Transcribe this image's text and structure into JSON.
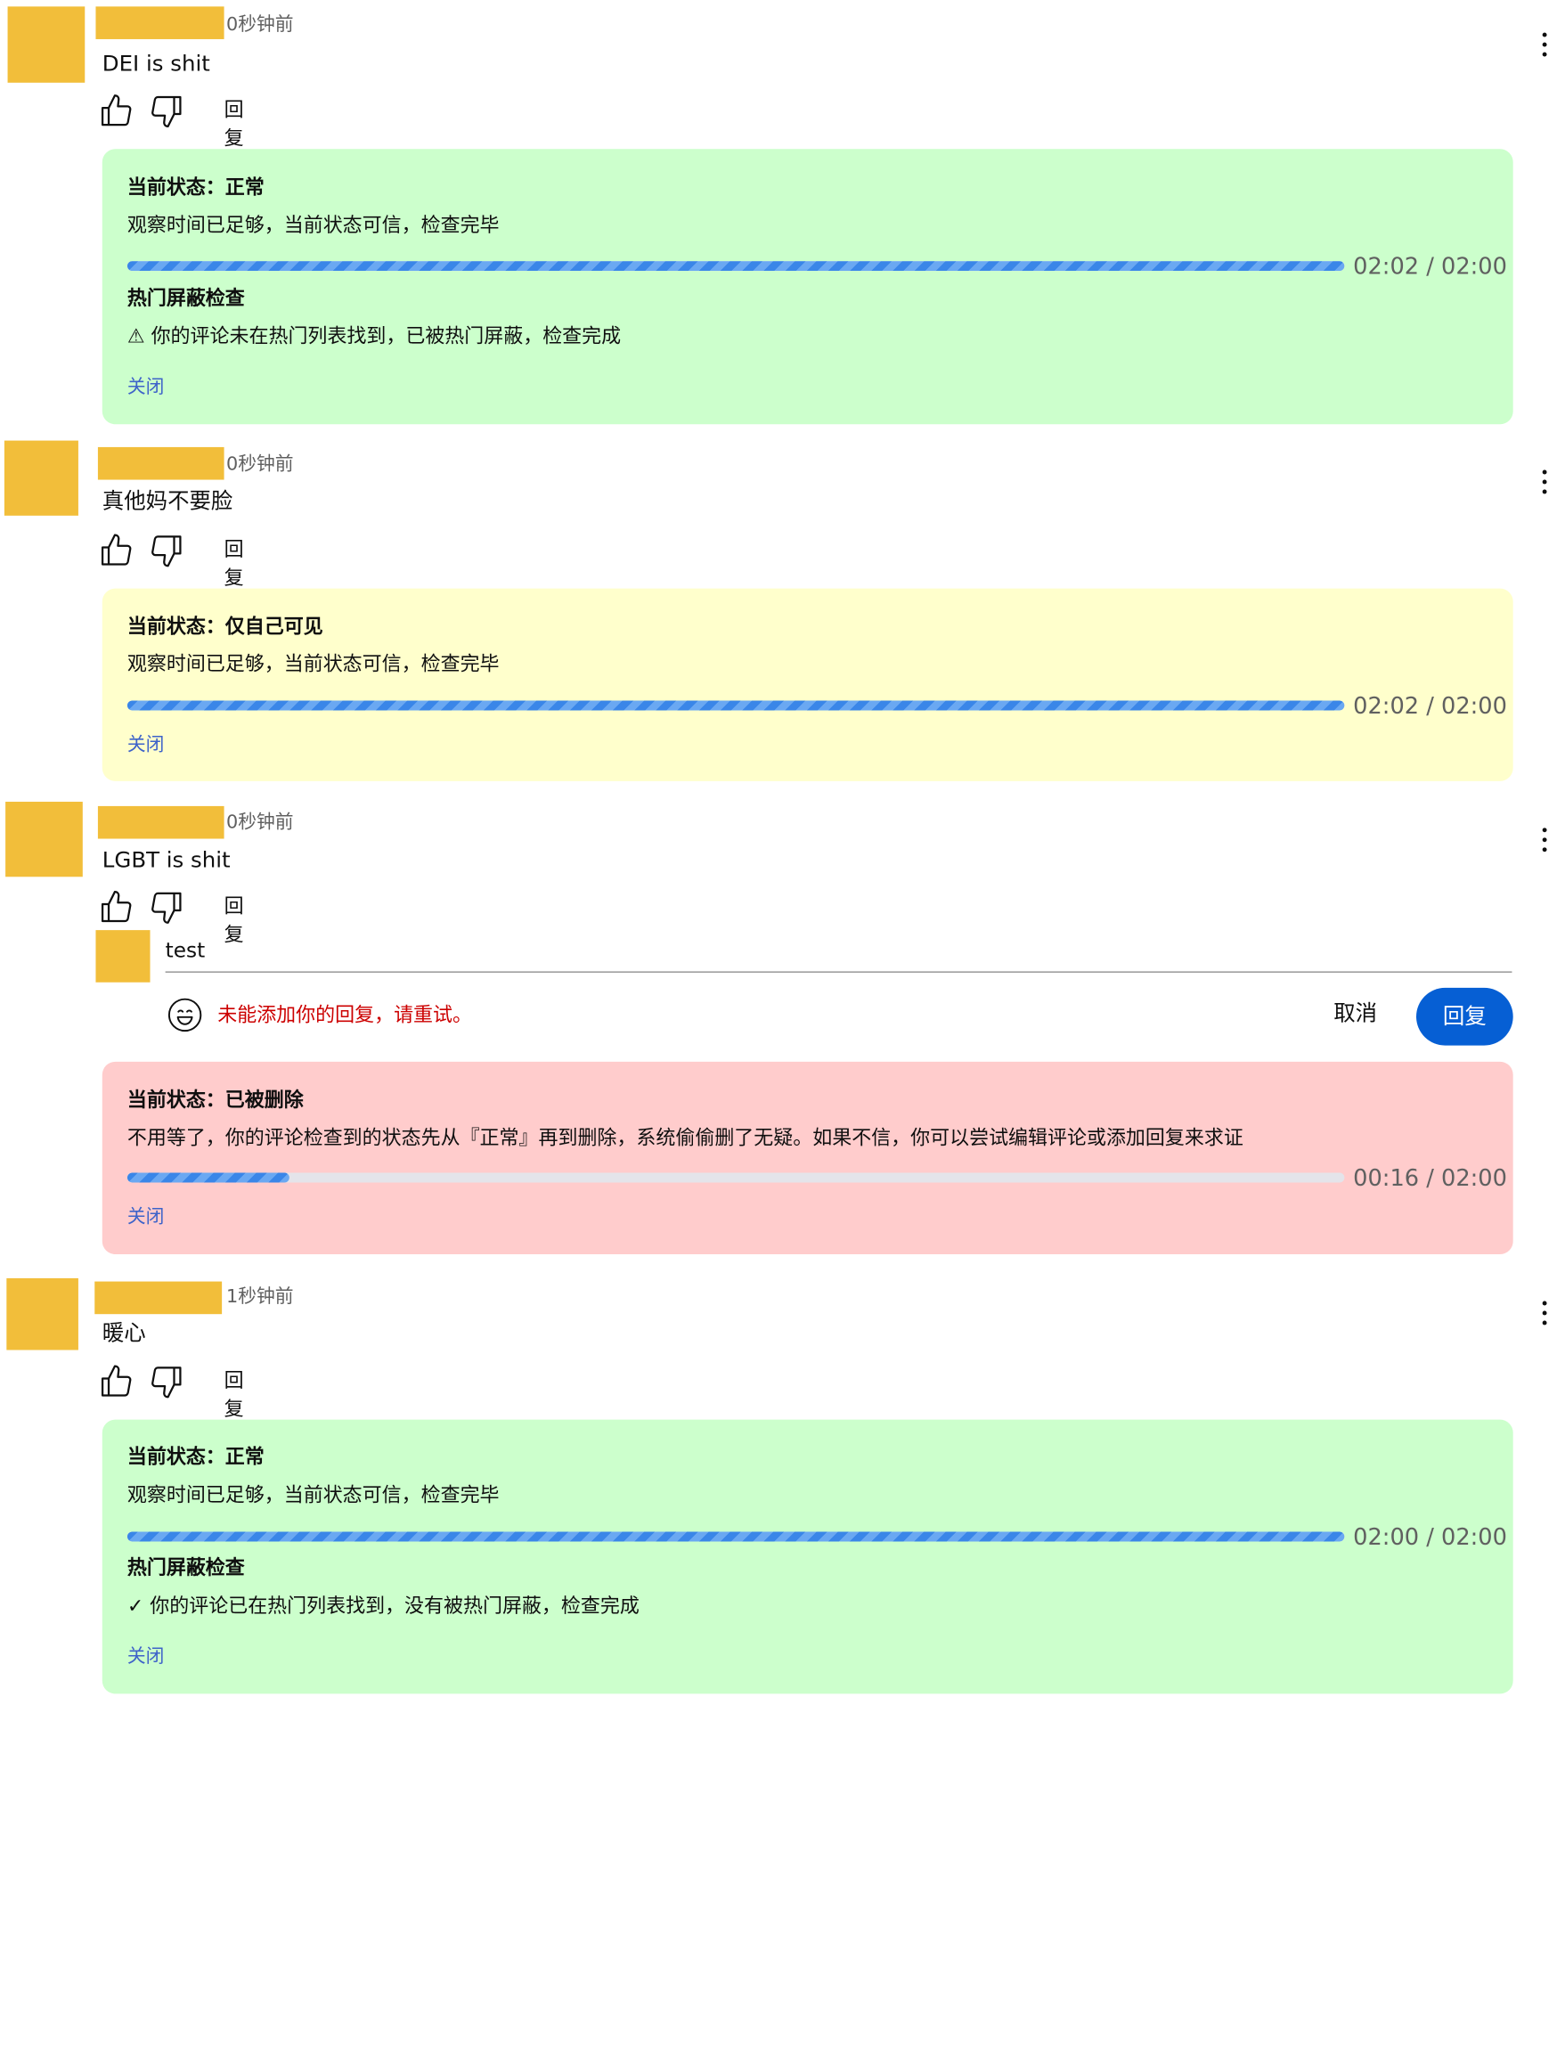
{
  "comments": [
    {
      "time": "0秒钟前",
      "text": "DEI is shit",
      "reply_label": "回复",
      "status": {
        "title": "当前状态：正常",
        "desc": "观察时间已足够，当前状态可信，检查完毕",
        "progress": 1.0,
        "time": "02:02 / 02:00",
        "hot_title": "热门屏蔽检查",
        "hot_result": "⚠ 你的评论未在热门列表找到，已被热门屏蔽，检查完成",
        "close": "关闭"
      }
    },
    {
      "time": "0秒钟前",
      "text": "真他妈不要脸",
      "reply_label": "回复",
      "status": {
        "title": "当前状态：仅自己可见",
        "desc": "观察时间已足够，当前状态可信，检查完毕",
        "progress": 1.0,
        "time": "02:02 / 02:00",
        "close": "关闭"
      }
    },
    {
      "time": "0秒钟前",
      "text": "LGBT is shit",
      "reply_label": "回复",
      "reply_box": {
        "input_value": "test",
        "error": "未能添加你的回复，请重试。",
        "cancel": "取消",
        "submit": "回复"
      },
      "status": {
        "title": "当前状态：已被删除",
        "desc": "不用等了，你的评论检查到的状态先从『正常』再到删除，系统偷偷删了无疑。如果不信，你可以尝试编辑评论或添加回复来求证",
        "progress": 0.1333,
        "time": "00:16 / 02:00",
        "close": "关闭"
      }
    },
    {
      "time": "1秒钟前",
      "text": "暖心",
      "reply_label": "回复",
      "status": {
        "title": "当前状态：正常",
        "desc": "观察时间已足够，当前状态可信，检查完毕",
        "progress": 1.0,
        "time": "02:00 / 02:00",
        "hot_title": "热门屏蔽检查",
        "hot_result": "✓ 你的评论已在热门列表找到，没有被热门屏蔽，检查完成",
        "close": "关闭"
      }
    }
  ],
  "colors": {
    "avatar": "#f2be3a",
    "status_normal": "#ccffcc",
    "status_private": "#ffffcc",
    "status_deleted": "#ffcccc",
    "progress": "#3a86e8",
    "link": "#3e63c9",
    "error": "#cc0000",
    "submit": "#065fd4"
  }
}
